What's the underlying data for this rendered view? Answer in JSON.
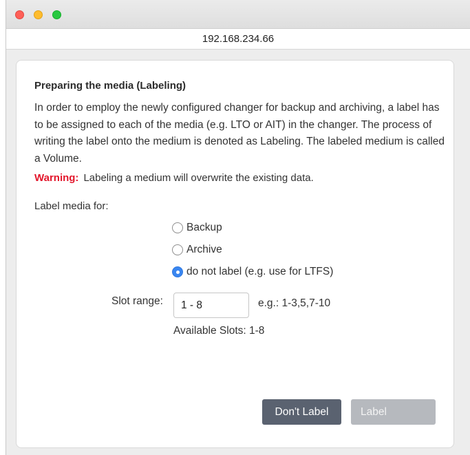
{
  "window": {
    "address": "192.168.234.66"
  },
  "dialog": {
    "heading": "Preparing the media (Labeling)",
    "description": "In order to employ the newly configured changer for backup and archiving, a label has to be assigned to each of the media (e.g. LTO or AIT) in the changer. The process of writing the label onto the medium is denoted as Labeling. The labeled medium is called a Volume.",
    "warning_label": "Warning:",
    "warning_text": "Labeling a medium will overwrite the existing data.",
    "label_media_prompt": "Label media for:",
    "options": [
      {
        "label": "Backup",
        "checked": false
      },
      {
        "label": "Archive",
        "checked": false
      },
      {
        "label": "do not label (e.g. use for LTFS)",
        "checked": true
      }
    ],
    "slot_range_label": "Slot range:",
    "slot_range_value": "1 - 8",
    "slot_range_hint": "e.g.: 1-3,5,7-10",
    "available_slots": "Available Slots: 1-8",
    "buttons": {
      "dont_label": "Don't Label",
      "label": "Label"
    }
  },
  "colors": {
    "warning": "#e3172c",
    "radio_checked": "#3a86f0",
    "primary_button": "#5a6270",
    "disabled_button": "#b6b9be"
  }
}
